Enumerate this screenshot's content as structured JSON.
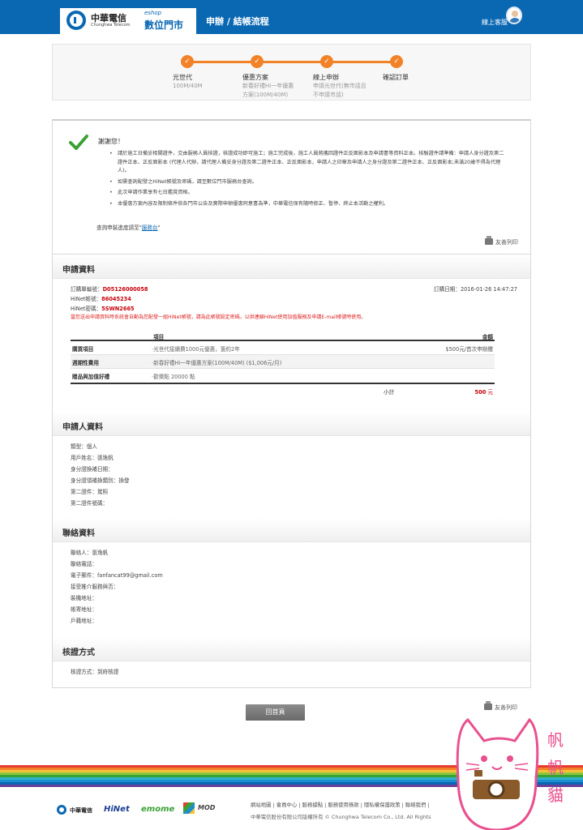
{
  "header": {
    "brand_cn": "中華電信",
    "brand_en": "Chunghwa Telecom",
    "eshop_label": "eshop",
    "store_label": "數位門市",
    "page_title": "申辦 / 結帳流程",
    "service_label": "線上客服"
  },
  "steps": [
    {
      "label": "光世代",
      "sub1": "100M/40M",
      "sub2": ""
    },
    {
      "label": "優惠方案",
      "sub1": "新春好禮Hi一年優惠",
      "sub2": "方案(100M/40M)"
    },
    {
      "label": "線上申辦",
      "sub1": "申請光世代(無市話且",
      "sub2": "不申請市話)"
    },
    {
      "label": "確認訂單",
      "sub1": "",
      "sub2": ""
    }
  ],
  "thanks": {
    "title": "謝謝您！",
    "bullets": [
      "請於施工日備妥相關證件，交由服務人員核證，核證成功即可施工；施工完成後，施工人員將攜回證件正反面影本及申請書等資料正本。核驗證件請準備：申請人身分證及第二證件正本、正反面影本 (代理人代辦，請代理人備妥身分證及第二證件正本、正反面影本，申請人之印章及申請人之身分證及第二證件正本、正反面影本;未滿20歲不得為代理人)。",
      "如需查詢配發之HiNet帳號及密碼，請至數位門市服務台查詢。",
      "此次申請作業享有七日鑑賞資格。",
      "本優惠方案內容及限制條件依各門市公告及實際申辦優惠同意書為準，中華電信保有隨時修正、暫停、終止本活動之權利。"
    ],
    "query_prefix": "查詢申裝進度請至\"",
    "query_link": "服務台",
    "query_suffix": "\"",
    "print_label": "友善列印"
  },
  "application": {
    "heading": "申請資料",
    "order_no_label": "訂購單編號：",
    "order_no": "D05126000058",
    "order_date_label": "訂購日期：",
    "order_date": "2016-01-26 14:47:27",
    "hinet_account_label": "HiNet帳號：",
    "hinet_account": "86045234",
    "hinet_password_label": "HiNet密碼：",
    "hinet_password": "5SWN2665",
    "note": "當您送出申請資料時系統會自動為您配發一組HiNet帳號，請為此帳號設定密碼，以供連線HiNet使用加值服務及申請E-mail帳號時使用。",
    "table_headers": {
      "item": "項目",
      "amount": "金額"
    },
    "rows": [
      {
        "category": "購買項目",
        "item": "‧光世代接續費1000元優惠，簽約2年",
        "amount": "$500元/首次申辦繳"
      },
      {
        "category": "週期性費用",
        "item": "‧新春好禮Hi一年優惠方案(100M/40M) ($1,006元/月)",
        "amount": ""
      },
      {
        "category": "贈品與加值好禮",
        "item": "‧歡樂點 20000 點",
        "amount": ""
      }
    ],
    "subtotal_label": "小計",
    "subtotal_value": "500",
    "subtotal_unit": " 元"
  },
  "applicant": {
    "heading": "申請人資料",
    "lines": [
      "類型：個人",
      "用戶姓名：張逸帆",
      "身分證換補日期：",
      "身分證領補換類別：換發",
      "第二證件：駕照",
      "第二證件號碼："
    ]
  },
  "contact": {
    "heading": "聯絡資料",
    "lines": [
      "聯絡人：張逸帆",
      "聯絡電話：",
      "電子郵件：fanfancat99@gmail.com",
      "接受推介服務與否：",
      "裝機地址：",
      "帳寄地址：",
      "戶籍地址："
    ]
  },
  "verify": {
    "heading": "核證方式",
    "line": "核證方式：到府核證"
  },
  "bottom": {
    "home_button": "回首頁",
    "print_label": "友善列印"
  },
  "footer": {
    "links": "網站地圖 | 會員中心 | 服務據點 | 服務使用條款 | 隱私權保護政策 | 聯絡我們 |",
    "copyright": "中華電信股份有限公司版權所有 © Chunghwa Telecom Co., Ltd. All Rights",
    "logo_cht": "中華電信",
    "logo_hinet": "HiNet",
    "logo_emome": "emome",
    "logo_mod": "MOD"
  },
  "watermark": {
    "text1": "帆",
    "text2": "帆",
    "text3": "貓"
  },
  "colors": {
    "brand_blue": "#0a68b3",
    "step_orange": "#f28227",
    "highlight_red": "#c7000b"
  }
}
